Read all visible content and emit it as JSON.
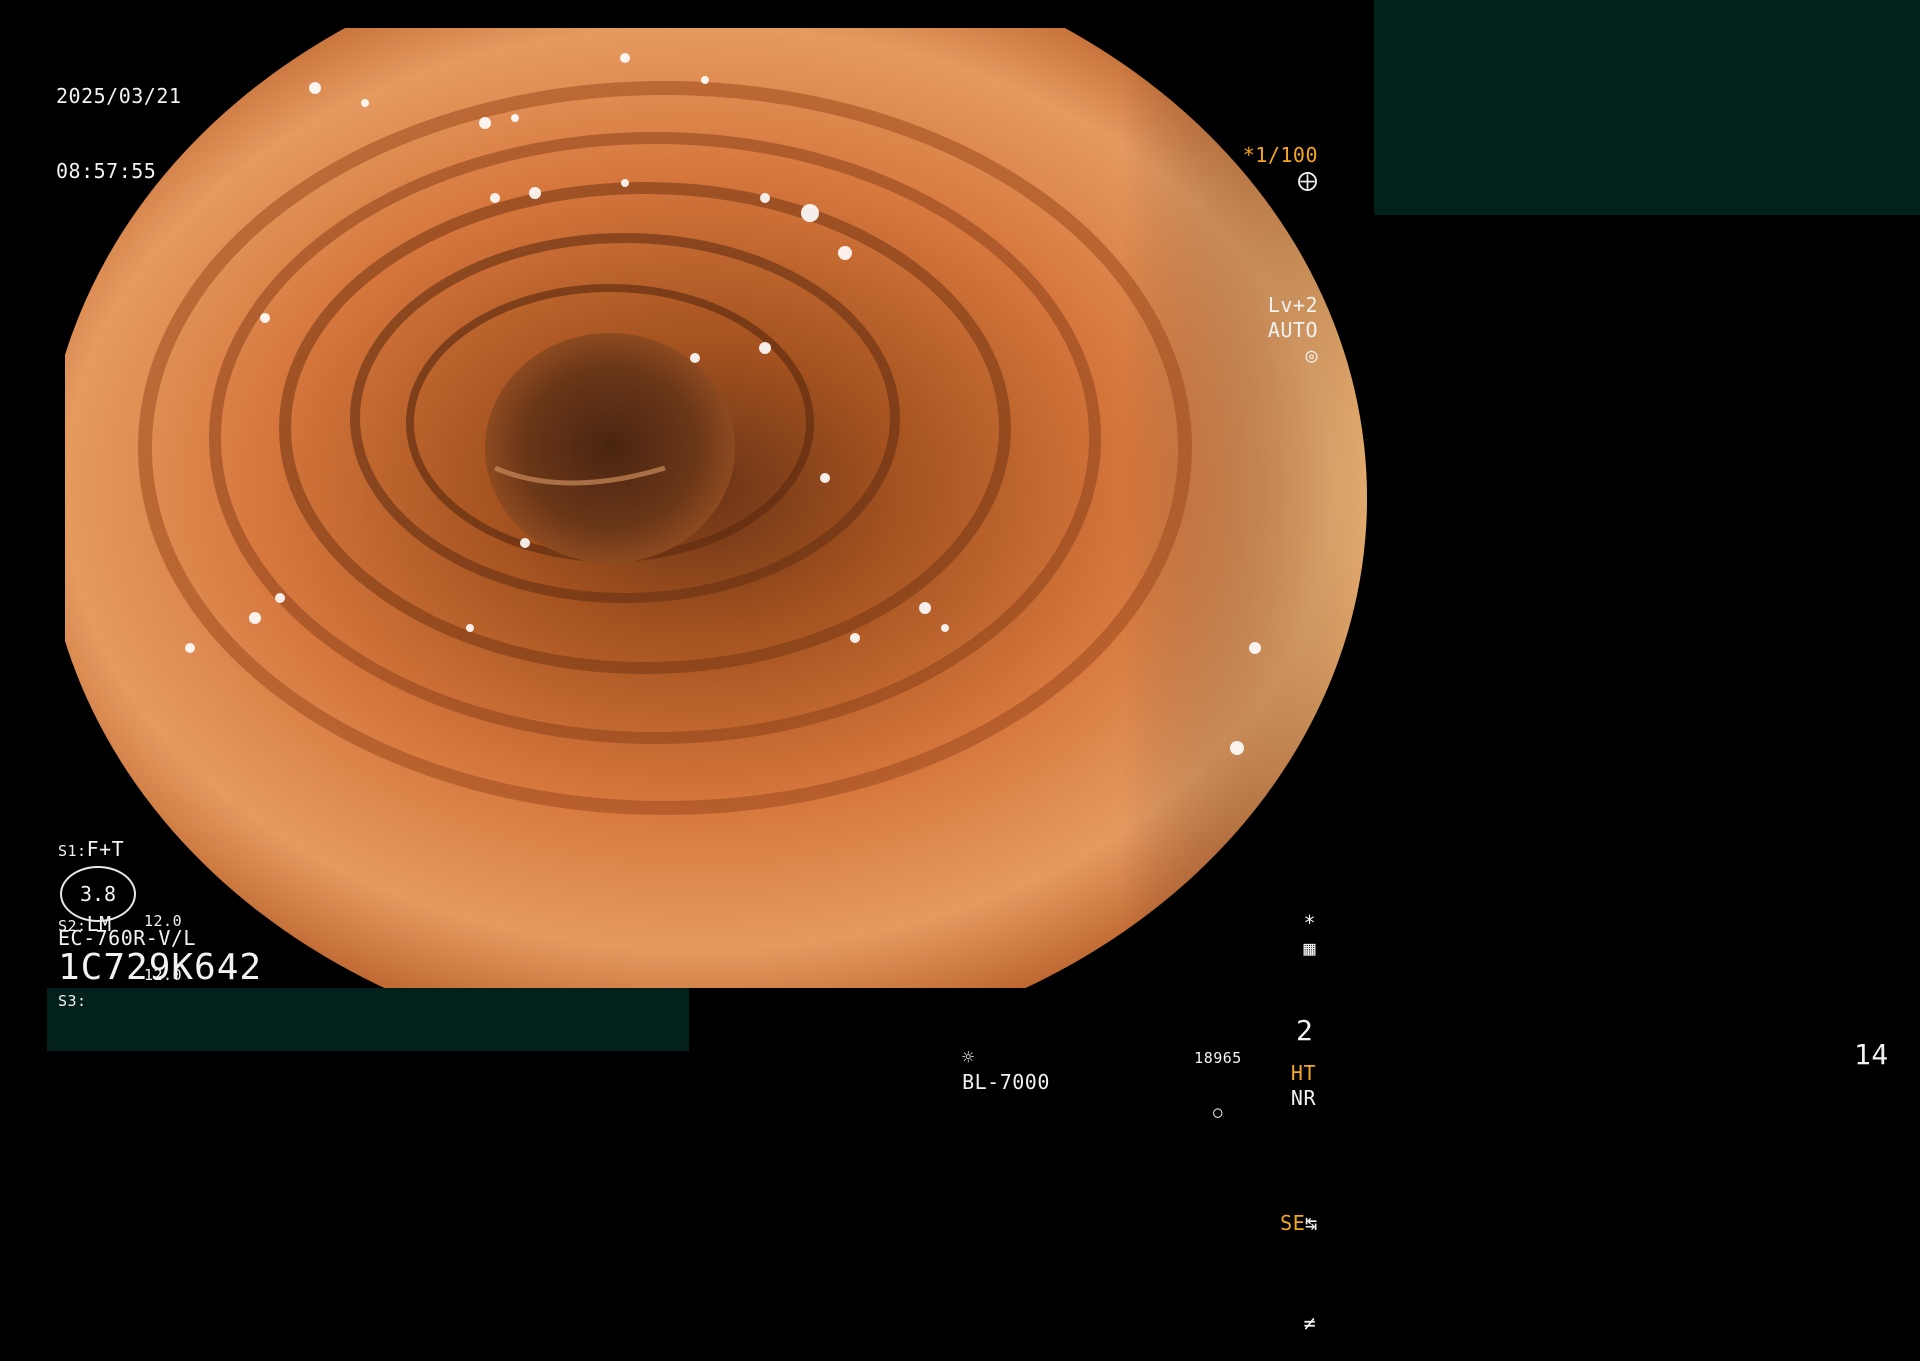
{
  "datetime": {
    "date": "2025/03/21",
    "time": "08:57:55"
  },
  "top_right_osd": {
    "shutter": "*1/100",
    "shutter_icon": "shutter-icon",
    "level": "Lv+2",
    "mode": "AUTO",
    "mode_icon": "auto-iris-icon"
  },
  "left_osd": {
    "s1_key": "S1:",
    "s1_value": "F+T",
    "s2_key": "S2:",
    "s2_value": "LM",
    "s3_key": "S3:",
    "s3_value": "",
    "zoom_value": "3.8",
    "scale_top": "12.0",
    "scale_bottom": "12.0",
    "scope_model": "EC-760R-V/L",
    "serial": "1C729K642"
  },
  "right_osd": {
    "star": "*",
    "menu_icon": "image-menu-icon",
    "ht": "HT",
    "nr": "NR",
    "se": "SE",
    "se_icon": "enhancement-icon",
    "sharpness_icon": "sharpness-icon"
  },
  "bottom_bar": {
    "light_icon": "light-source-icon",
    "light_source": "BL-7000",
    "counter": "18965",
    "counter_icon": "storage-icon",
    "channel": "2"
  },
  "page_number": "14",
  "colors": {
    "mucosa": "#d8743e",
    "mask_panel": "#02201c",
    "osd_text": "#f2f2f2",
    "osd_accent": "#f5a623"
  }
}
